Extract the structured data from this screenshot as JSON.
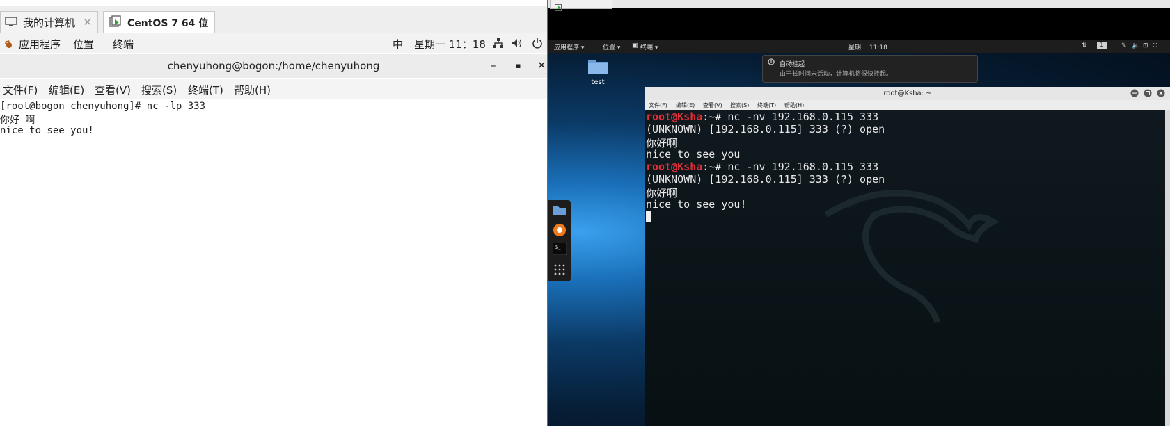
{
  "left_vm": {
    "tabs": [
      {
        "label": "我的计算机",
        "icon": "monitor-icon"
      },
      {
        "label": "CentOS 7 64 位",
        "icon": "vm-icon"
      }
    ],
    "gnome_bar": {
      "applications": "应用程序",
      "places": "位置",
      "terminal": "终端",
      "input_method": "中",
      "datetime": "星期一 11：18"
    },
    "window_title": "chenyuhong@bogon:/home/chenyuhong",
    "menu": [
      "文件(F)",
      "编辑(E)",
      "查看(V)",
      "搜索(S)",
      "终端(T)",
      "帮助(H)"
    ],
    "terminal_lines": [
      "[root@bogon chenyuhong]# nc -lp 333",
      "你好 啊",
      "nice to see you!"
    ]
  },
  "right_vm": {
    "top_bar": {
      "applications": "应用程序 ▾",
      "places": "位置 ▾",
      "terminal": "终端 ▾",
      "datetime": "星期一 11:18",
      "workspace": "1"
    },
    "desktop_icon_label": "test",
    "notification": {
      "title": "自动挂起",
      "body": "由于长时间未活动，计算机将很快挂起。"
    },
    "terminal": {
      "title": "root@Ksha: ~",
      "menu": [
        "文件(F)",
        "编辑(E)",
        "查看(V)",
        "搜索(S)",
        "终端(T)",
        "帮助(H)"
      ],
      "prompt_user": "root@Ksha",
      "prompt_tail": ":~# ",
      "command": "nc -nv 192.168.0.115 333",
      "open_line": "(UNKNOWN) [192.168.0.115] 333 (?) open",
      "greeting": "你好啊",
      "msg1": "nice to see you",
      "msg2": "nice to see you!"
    }
  },
  "colors": {
    "divider": "#d83a3a",
    "prompt_red": "#e0303a",
    "kali_blue": "#1a6fb8"
  }
}
